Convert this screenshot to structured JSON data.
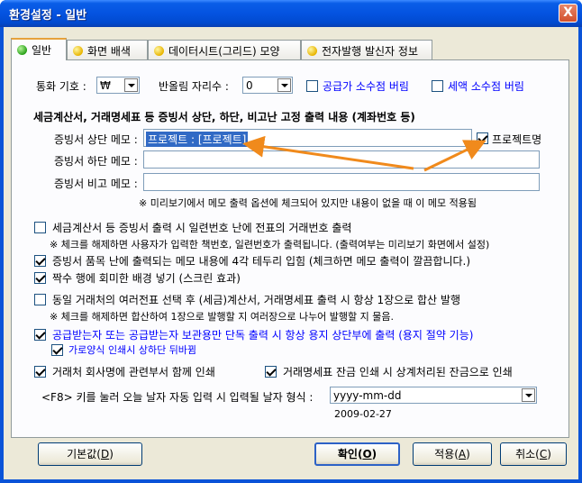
{
  "window": {
    "title": "환경설정 - 일반",
    "close_glyph": "X"
  },
  "tabs": [
    {
      "label": "일반"
    },
    {
      "label": "화면 배색"
    },
    {
      "label": "데이터시트(그리드) 모양"
    },
    {
      "label": "전자발행 발신자 정보"
    }
  ],
  "currency": {
    "label": "통화 기호 :",
    "value": "₩"
  },
  "rounding": {
    "label": "반올림 자리수 :",
    "value": "0"
  },
  "opt_supply_round": {
    "label": "공급가 소수점 버림",
    "checked": false
  },
  "opt_tax_round": {
    "label": "세액 소수점 버림",
    "checked": false
  },
  "memo_section_title": "세금계산서, 거래명세표 등 증빙서 상단, 하단, 비고난 고정 출력 내용 (계좌번호 등)",
  "memo_top": {
    "label": "증빙서 상단 메모 :",
    "value": "프로젝트 : [프로젝트]"
  },
  "memo_project_name": {
    "label": "프로젝트명",
    "checked": true
  },
  "memo_bottom": {
    "label": "증빙서 하단 메모 :",
    "value": ""
  },
  "memo_note": {
    "label": "증빙서 비고 메모 :",
    "value": ""
  },
  "memo_hint": "※ 미리보기에서 메모 출력 옵션에 체크되어 있지만 내용이 없을 때 이 메모 적용됨",
  "opt_serial": {
    "label": "세금계산서 등 증빙서 출력 시 일련번호 난에 전표의 거래번호 출력",
    "checked": false
  },
  "opt_serial_note": "※ 체크를 해제하면 사용자가 입력한 책번호, 일련번호가 출력됩니다. (출력여부는 미리보기 화면에서 설정)",
  "opt_border": {
    "label": "증빙서 품목 난에 출력되는 메모 내용에 4각 테두리 입힘 (체크하면 메모 출력이 깔끔합니다.)",
    "checked": true
  },
  "opt_even_rows": {
    "label": "짝수 행에 회미한 배경 넣기 (스크린 효과)",
    "checked": true
  },
  "opt_merge": {
    "label": "동일 거래처의 여러전표 선택 후 (세금)계산서, 거래명세표 출력 시 항상 1장으로 합산 발행",
    "checked": false
  },
  "opt_merge_note": "※ 체크를 해제하면 합산하여 1장으로 발행할 지 여러장으로 나누어 발행할 지 물음.",
  "opt_receiver_copy": {
    "label": "공급받는자 또는 공급받는자 보관용만 단독 출력 시 항상 용지 상단부에 출력 (용지 절약 기능)",
    "checked": true
  },
  "opt_flip": {
    "label": "가로양식 인쇄시 상하단 뒤바뀜",
    "checked": true
  },
  "opt_dept": {
    "label": "거래처 회사명에 관련부서 함께 인쇄",
    "checked": true
  },
  "opt_balance": {
    "label": "거래명세표 잔금 인쇄 시 상계처리된 잔금으로 인쇄",
    "checked": true
  },
  "date_format": {
    "label": "<F8> 키를 눌러 오늘 날자 자동 입력 시 입력될 날자 형식 :",
    "value": "yyyy-mm-dd",
    "preview": "2009-02-27"
  },
  "buttons": {
    "defaults": {
      "label": "기본값(",
      "key": "D",
      "tail": ")"
    },
    "ok": {
      "label": "확인(",
      "key": "O",
      "tail": ")"
    },
    "apply": {
      "label": "적용(",
      "key": "A",
      "tail": ")"
    },
    "cancel": {
      "label": "취소(",
      "key": "C",
      "tail": ")"
    }
  },
  "colors": {
    "title_bar": "#0453e0",
    "arrow": "#f08a1c",
    "link_blue": "#0000ff",
    "selection": "#316ac5"
  },
  "icons": {
    "tab_active": "green-dot-icon",
    "tab_inactive": "yellow-dot-icon",
    "close": "close-icon",
    "dropdown": "chevron-down-icon"
  }
}
